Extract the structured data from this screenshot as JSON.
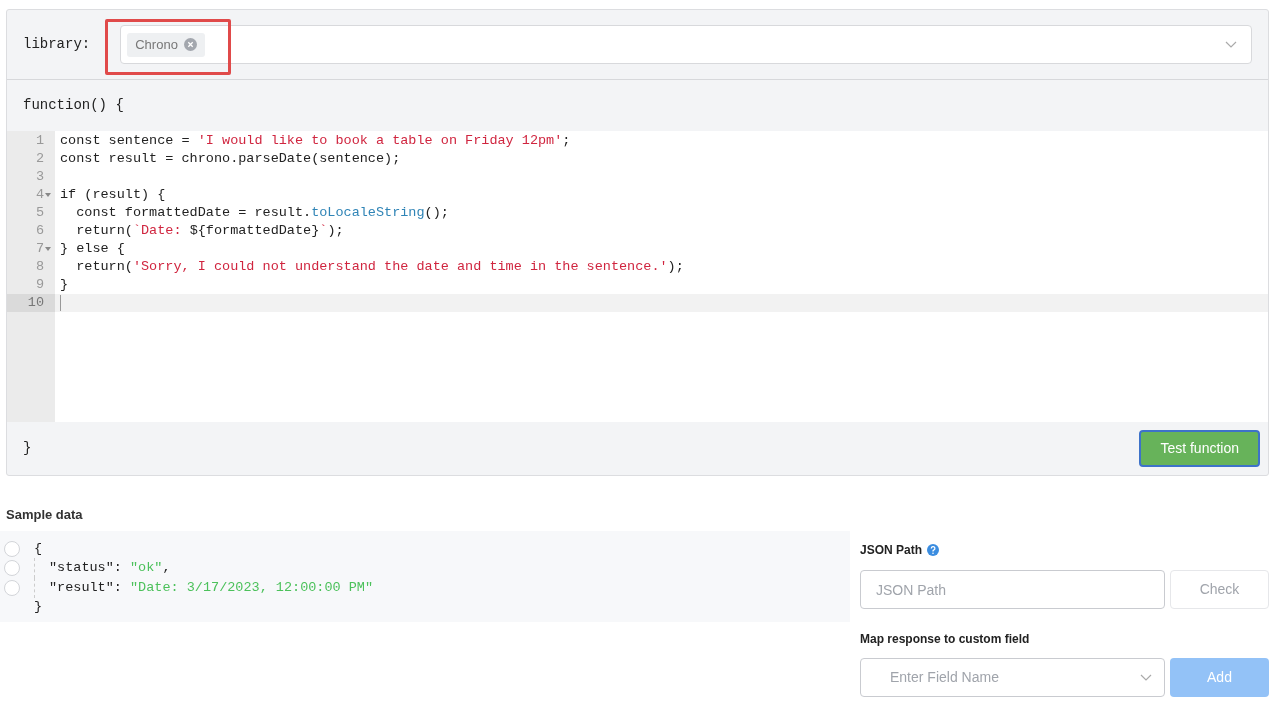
{
  "library": {
    "label": "library:",
    "tags": [
      {
        "text": "Chrono"
      }
    ]
  },
  "function_open": "function() {",
  "code": [
    {
      "number": "1",
      "foldable": false,
      "active": false,
      "tokens": [
        {
          "kind": "plain",
          "text": "const sentence = "
        },
        {
          "kind": "string",
          "text": "'I would like to book a table on Friday 12pm'"
        },
        {
          "kind": "plain",
          "text": ";"
        }
      ]
    },
    {
      "number": "2",
      "foldable": false,
      "active": false,
      "tokens": [
        {
          "kind": "plain",
          "text": "const result = chrono.parseDate(sentence);"
        }
      ]
    },
    {
      "number": "3",
      "foldable": false,
      "active": false
    },
    {
      "number": "4",
      "foldable": true,
      "active": false,
      "tokens": [
        {
          "kind": "plain",
          "text": "if (result) {"
        }
      ]
    },
    {
      "number": "5",
      "foldable": false,
      "active": false,
      "tokens": [
        {
          "kind": "plain",
          "text": "  const formattedDate = result."
        },
        {
          "kind": "method",
          "text": "toLocaleString"
        },
        {
          "kind": "plain",
          "text": "();"
        }
      ]
    },
    {
      "number": "6",
      "foldable": false,
      "active": false,
      "tokens": [
        {
          "kind": "plain",
          "text": "  return("
        },
        {
          "kind": "string",
          "text": "`Date: "
        },
        {
          "kind": "plain",
          "text": "${formattedDate}"
        },
        {
          "kind": "string",
          "text": "`"
        },
        {
          "kind": "plain",
          "text": ");"
        }
      ]
    },
    {
      "number": "7",
      "foldable": true,
      "active": false,
      "tokens": [
        {
          "kind": "plain",
          "text": "} else {"
        }
      ]
    },
    {
      "number": "8",
      "foldable": false,
      "active": false,
      "tokens": [
        {
          "kind": "plain",
          "text": "  return("
        },
        {
          "kind": "string",
          "text": "'Sorry, I could not understand the date and time in the sentence.'"
        },
        {
          "kind": "plain",
          "text": ");"
        }
      ]
    },
    {
      "number": "9",
      "foldable": false,
      "active": false,
      "tokens": [
        {
          "kind": "plain",
          "text": "}"
        }
      ]
    },
    {
      "number": "10",
      "foldable": false,
      "active": true
    }
  ],
  "function_close": "}",
  "test_button": "Test function",
  "sample": {
    "title": "Sample data",
    "lines": [
      {
        "selected": false,
        "indent": false,
        "tokens": [
          {
            "kind": "punct",
            "text": "{"
          }
        ]
      },
      {
        "selected": false,
        "indent": true,
        "tokens": [
          {
            "kind": "key",
            "text": "\"status\""
          },
          {
            "kind": "punct",
            "text": ": "
          },
          {
            "kind": "string",
            "text": "\"ok\""
          },
          {
            "kind": "punct",
            "text": ","
          }
        ]
      },
      {
        "selected": false,
        "indent": true,
        "tokens": [
          {
            "kind": "key",
            "text": "\"result\""
          },
          {
            "kind": "punct",
            "text": ": "
          },
          {
            "kind": "string",
            "text": "\"Date: 3/17/2023, 12:00:00 PM\""
          }
        ]
      },
      {
        "indent": false,
        "tokens": [
          {
            "kind": "punct",
            "text": "}"
          }
        ]
      }
    ]
  },
  "json_path": {
    "label": "JSON Path",
    "placeholder": "JSON Path",
    "button": "Check"
  },
  "map": {
    "label": "Map response to custom field",
    "placeholder": "Enter Field Name",
    "button": "Add",
    "button_disabled": true
  }
}
